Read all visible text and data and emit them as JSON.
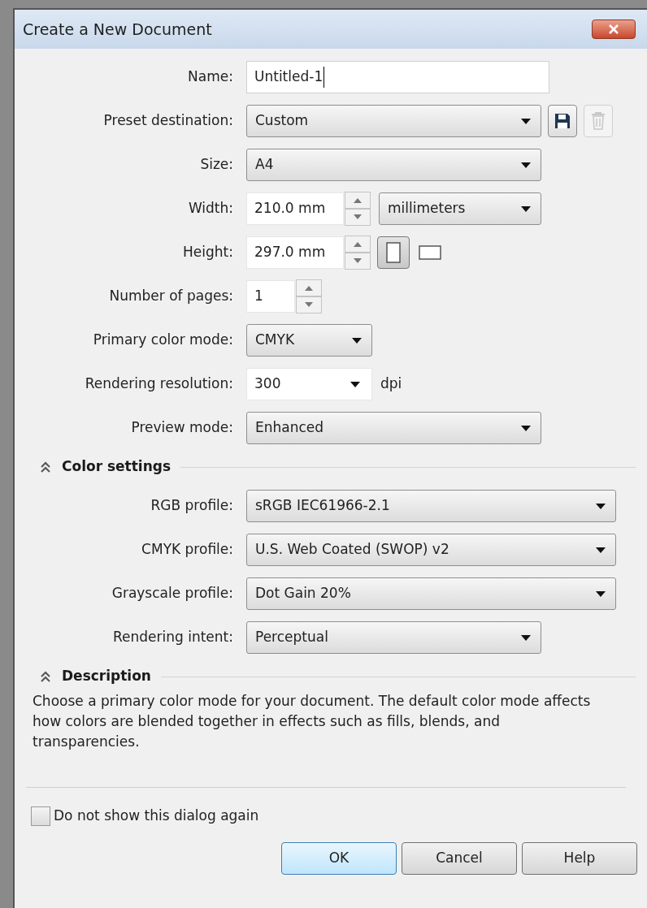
{
  "window": {
    "title": "Create a New Document"
  },
  "general": [
    {
      "label": "Name:",
      "kind": "text",
      "value": "Untitled-1"
    },
    {
      "label": "Preset destination:",
      "kind": "dropdown",
      "value": "Custom",
      "actions": [
        {
          "kind": "save",
          "disabled": false
        },
        {
          "kind": "delete",
          "disabled": true
        }
      ]
    },
    {
      "label": "Size:",
      "kind": "dropdown",
      "value": "A4"
    },
    {
      "label": "Width:",
      "kind": "spin",
      "value": "210.0 mm",
      "unit": "millimeters"
    },
    {
      "label": "Height:",
      "kind": "spin",
      "value": "297.0 mm",
      "orientation": [
        {
          "kind": "portrait",
          "selected": true
        },
        {
          "kind": "landscape",
          "selected": false
        }
      ]
    },
    {
      "label": "Number of pages:",
      "kind": "spin_small",
      "value": "1"
    },
    {
      "label": "Primary color mode:",
      "kind": "dropdown_small",
      "value": "CMYK"
    },
    {
      "label": "Rendering resolution:",
      "kind": "combo",
      "value": "300",
      "suffix": "dpi"
    },
    {
      "label": "Preview mode:",
      "kind": "dropdown",
      "value": "Enhanced"
    }
  ],
  "color_settings": {
    "title": "Color settings",
    "expanded": true,
    "rows": [
      {
        "label": "RGB profile:",
        "kind": "dropdown_wide",
        "value": "sRGB IEC61966-2.1"
      },
      {
        "label": "CMYK profile:",
        "kind": "dropdown_wide",
        "value": "U.S. Web Coated (SWOP) v2"
      },
      {
        "label": "Grayscale profile:",
        "kind": "dropdown_wide",
        "value": "Dot Gain 20%"
      },
      {
        "label": "Rendering intent:",
        "kind": "dropdown",
        "value": "Perceptual"
      }
    ]
  },
  "description": {
    "title": "Description",
    "expanded": true,
    "text": "Choose a primary color mode for your document. The default color mode affects how colors are blended together in effects such as fills, blends, and transparencies."
  },
  "dont_show_again": {
    "label": "Do not show this dialog again",
    "checked": false
  },
  "buttons": [
    {
      "label": "OK",
      "default": true
    },
    {
      "label": "Cancel",
      "default": false
    },
    {
      "label": "Help",
      "default": false
    }
  ]
}
